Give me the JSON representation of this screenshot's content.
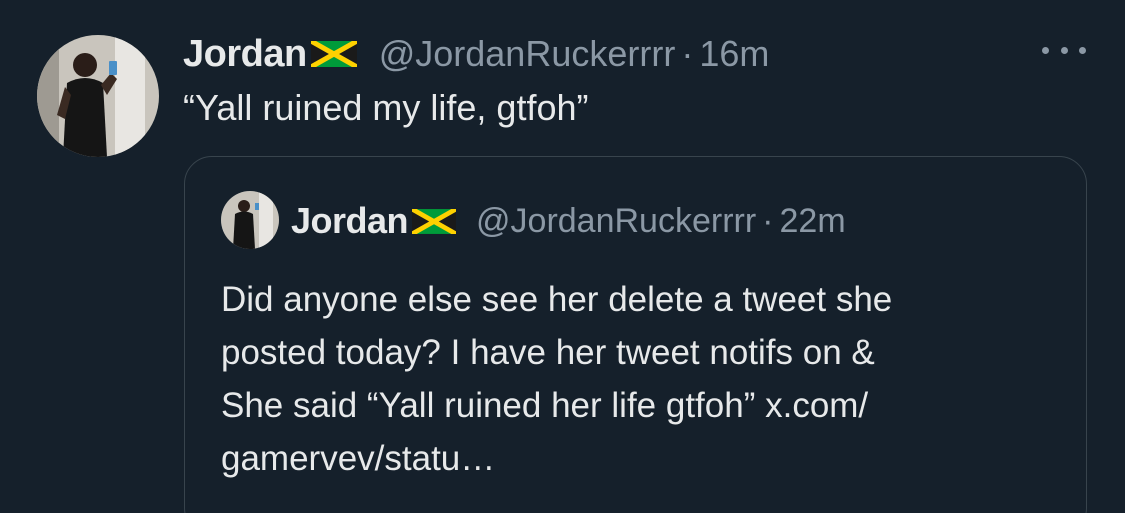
{
  "tweet": {
    "author_name": "Jordan",
    "flag": "jamaica-flag",
    "handle": "@JordanRuckerrrr",
    "separator": "·",
    "time": "16m",
    "text": "“Yall ruined my life, gtfoh”",
    "more_icon": "more-horizontal-icon"
  },
  "quoted_tweet": {
    "author_name": "Jordan",
    "flag": "jamaica-flag",
    "handle": "@JordanRuckerrrr",
    "separator": "·",
    "time": "22m",
    "text_lines": [
      "Did anyone else see her delete a tweet she",
      "posted today? I have her tweet notifs on &",
      "She said “Yall ruined her life gtfoh” x.com/",
      "gamervev/statu…"
    ]
  },
  "colors": {
    "background": "#15202b",
    "primary_text": "#e7e9ea",
    "secondary_text": "#8b98a5",
    "border": "#38444d"
  }
}
